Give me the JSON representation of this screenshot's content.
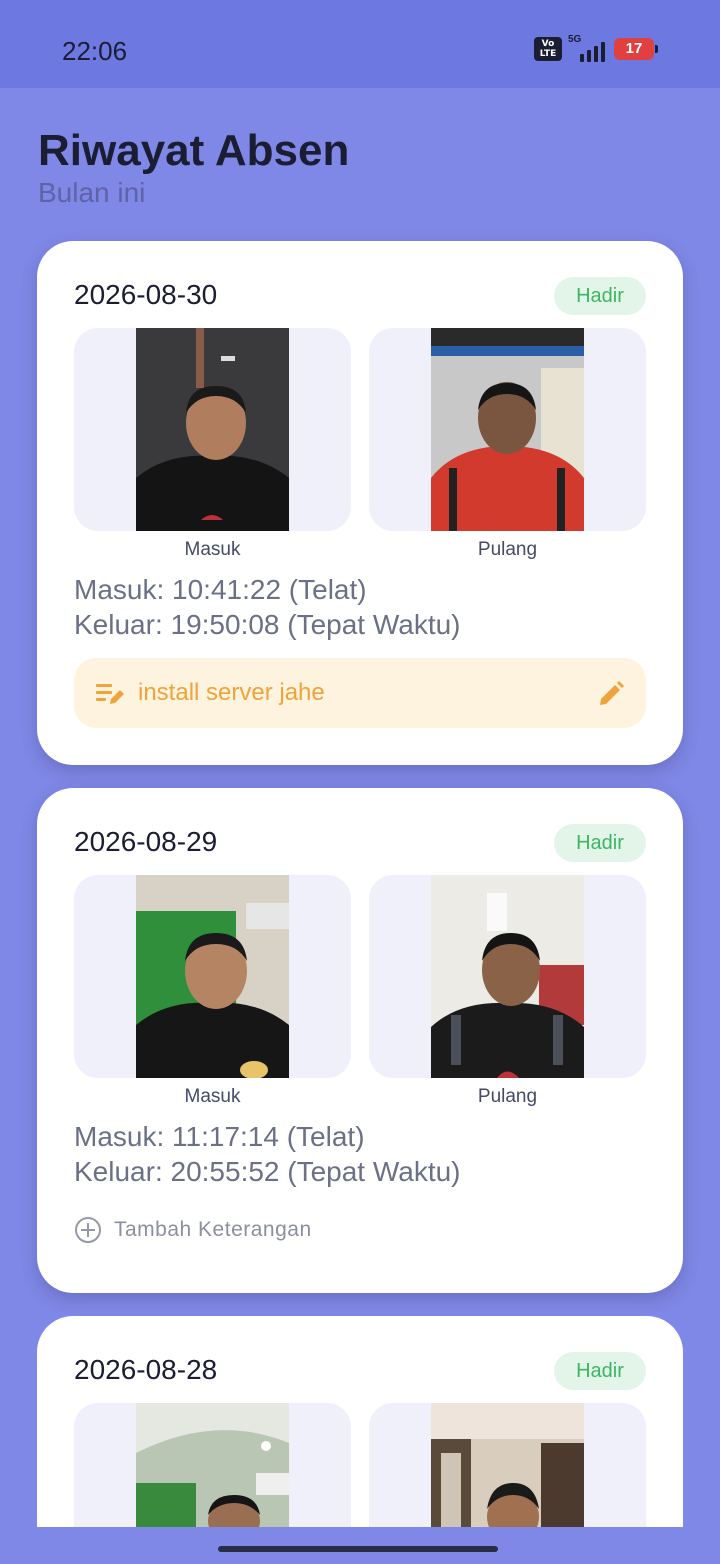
{
  "status_bar": {
    "time": "22:06",
    "volte_label": "VoLTE",
    "network": "5G",
    "battery": "17"
  },
  "header": {
    "title": "Riwayat Absen",
    "subtitle": "Bulan ini"
  },
  "records": [
    {
      "date": "2026-08-30",
      "status": "Hadir",
      "photo_in_label": "Masuk",
      "photo_out_label": "Pulang",
      "check_in": "Masuk: 10:41:22 (Telat)",
      "check_out": "Keluar: 19:50:08 (Tepat Waktu)",
      "note": "install server jahe"
    },
    {
      "date": "2026-08-29",
      "status": "Hadir",
      "photo_in_label": "Masuk",
      "photo_out_label": "Pulang",
      "check_in": "Masuk: 11:17:14 (Telat)",
      "check_out": "Keluar: 20:55:52 (Tepat Waktu)",
      "add_note_label": "Tambah Keterangan"
    },
    {
      "date": "2026-08-28",
      "status": "Hadir"
    }
  ],
  "colors": {
    "background": "#7f88e6",
    "status_bar": "#6d78e0",
    "badge_text": "#3db562",
    "badge_bg": "#e3f5e8",
    "note_text": "#eea43a",
    "note_bg": "#fef3de"
  }
}
